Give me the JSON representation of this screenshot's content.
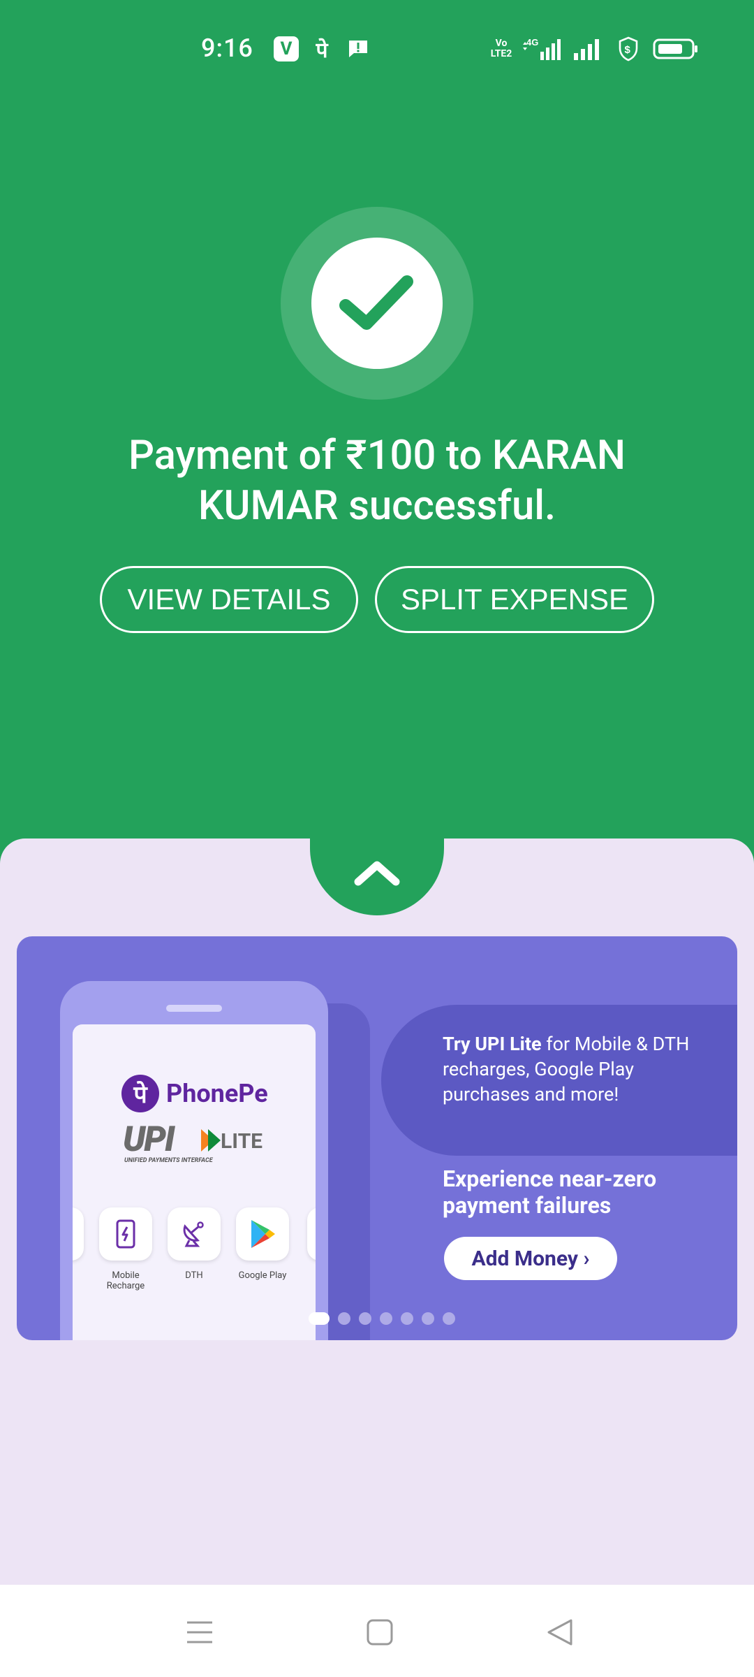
{
  "status_bar": {
    "time": "9:16",
    "notif_v": "V",
    "notif_pe": "पे",
    "network_label_1": "Vo",
    "network_label_2": "LTE2",
    "network_4g": "4G"
  },
  "success": {
    "message": "Payment of ₹100 to KARAN KUMAR successful.",
    "view_details_label": "VIEW DETAILS",
    "split_expense_label": "SPLIT EXPENSE"
  },
  "banner": {
    "brand": "PhonePe",
    "brand_glyph": "पे",
    "upi": "UPI",
    "lite": "LITE",
    "upi_subtitle": "UNIFIED PAYMENTS INTERFACE",
    "services": [
      {
        "label": "Mobile Recharge"
      },
      {
        "label": "DTH"
      },
      {
        "label": "Google Play"
      }
    ],
    "promo_bold": "Try UPI Lite",
    "promo_rest": " for Mobile & DTH recharges, Google Play purchases and more!",
    "headline": "Experience near-zero payment failures",
    "cta_label": "Add Money ›",
    "total_slides": 7,
    "active_slide": 1
  },
  "colors": {
    "primary_green": "#23a25b",
    "sheet_bg": "#ede4f5",
    "banner_bg": "#7571d8",
    "phonepe_purple": "#5f259f"
  },
  "navbar": {
    "icons": [
      "menu-icon",
      "home-square-icon",
      "back-triangle-icon"
    ]
  }
}
